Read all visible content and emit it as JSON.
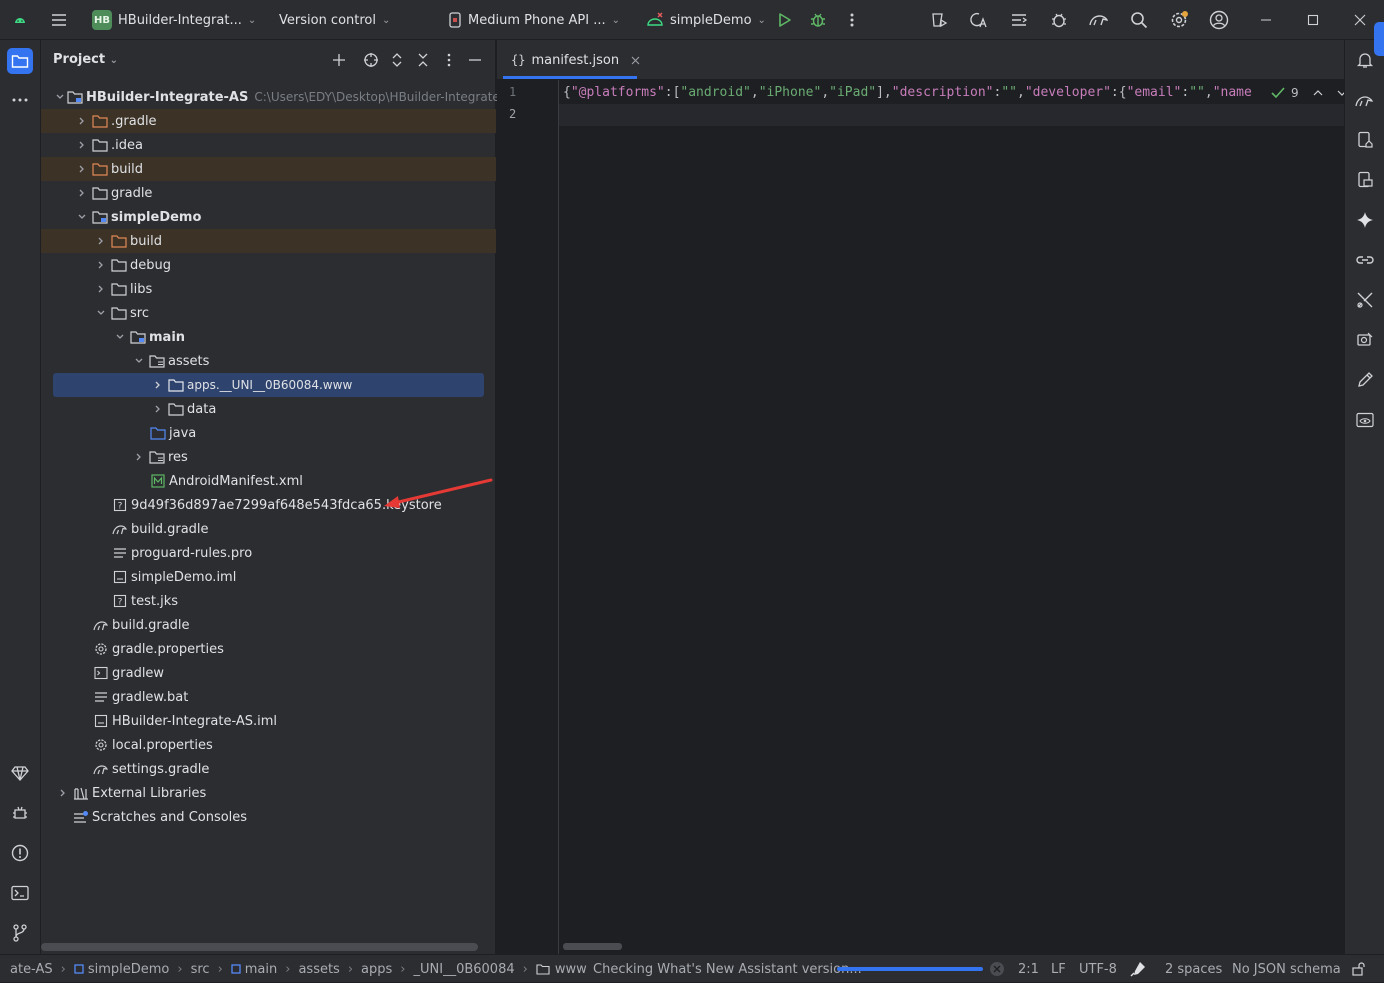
{
  "titlebar": {
    "project_badge": "HB",
    "project_name": "HBuilder-Integrat...",
    "vcs": "Version control",
    "device": "Medium Phone API ...",
    "run_config": "simpleDemo"
  },
  "project_panel": {
    "title": "Project",
    "tree": [
      {
        "label": "HBuilder-Integrate-AS",
        "path": "C:\\Users\\EDY\\Desktop\\HBuilder-Integrate-AS"
      },
      {
        "label": ".gradle"
      },
      {
        "label": ".idea"
      },
      {
        "label": "build"
      },
      {
        "label": "gradle"
      },
      {
        "label": "simpleDemo"
      },
      {
        "label": "build"
      },
      {
        "label": "debug"
      },
      {
        "label": "libs"
      },
      {
        "label": "src"
      },
      {
        "label": "main"
      },
      {
        "label": "assets"
      },
      {
        "label": "apps.__UNI__0B60084.www"
      },
      {
        "label": "data"
      },
      {
        "label": "java"
      },
      {
        "label": "res"
      },
      {
        "label": "AndroidManifest.xml"
      },
      {
        "label": "9d49f36d897ae7299af648e543fdca65.keystore"
      },
      {
        "label": "build.gradle"
      },
      {
        "label": "proguard-rules.pro"
      },
      {
        "label": "simpleDemo.iml"
      },
      {
        "label": "test.jks"
      },
      {
        "label": "build.gradle"
      },
      {
        "label": "gradle.properties"
      },
      {
        "label": "gradlew"
      },
      {
        "label": "gradlew.bat"
      },
      {
        "label": "HBuilder-Integrate-AS.iml"
      },
      {
        "label": "local.properties"
      },
      {
        "label": "settings.gradle"
      },
      {
        "label": "External Libraries"
      },
      {
        "label": "Scratches and Consoles"
      }
    ]
  },
  "editor": {
    "tab": "manifest.json",
    "lines": [
      "1",
      "2"
    ],
    "code": [
      {
        "t": "{",
        "c": "p"
      },
      {
        "t": "\"@platforms\"",
        "c": "k"
      },
      {
        "t": ":[",
        "c": "p"
      },
      {
        "t": "\"android\"",
        "c": "s"
      },
      {
        "t": ",",
        "c": "p"
      },
      {
        "t": "\"iPhone\"",
        "c": "s"
      },
      {
        "t": ",",
        "c": "p"
      },
      {
        "t": "\"iPad\"",
        "c": "s"
      },
      {
        "t": "],",
        "c": "p"
      },
      {
        "t": "\"description\"",
        "c": "k"
      },
      {
        "t": ":",
        "c": "p"
      },
      {
        "t": "\"\"",
        "c": "s"
      },
      {
        "t": ",",
        "c": "p"
      },
      {
        "t": "\"developer\"",
        "c": "k"
      },
      {
        "t": ":{",
        "c": "p"
      },
      {
        "t": "\"email\"",
        "c": "k"
      },
      {
        "t": ":",
        "c": "p"
      },
      {
        "t": "\"\"",
        "c": "s"
      },
      {
        "t": ",",
        "c": "p"
      },
      {
        "t": "\"name",
        "c": "k"
      }
    ],
    "inspection_count": "9"
  },
  "statusbar": {
    "breadcrumb": [
      "ate-AS",
      "simpleDemo",
      "src",
      "main",
      "assets",
      "apps",
      "_UNI__0B60084",
      "www"
    ],
    "task": "Checking What's New Assistant version...",
    "task_progress": 1.0,
    "position": "2:1",
    "line_sep": "LF",
    "encoding": "UTF-8",
    "indent": "2 spaces",
    "schema": "No JSON schema"
  },
  "colors": {
    "accent": "#3574f0",
    "excluded_bg": "#3c3226",
    "selection": "#2e436e",
    "annotation_arrow": "#e53935"
  }
}
